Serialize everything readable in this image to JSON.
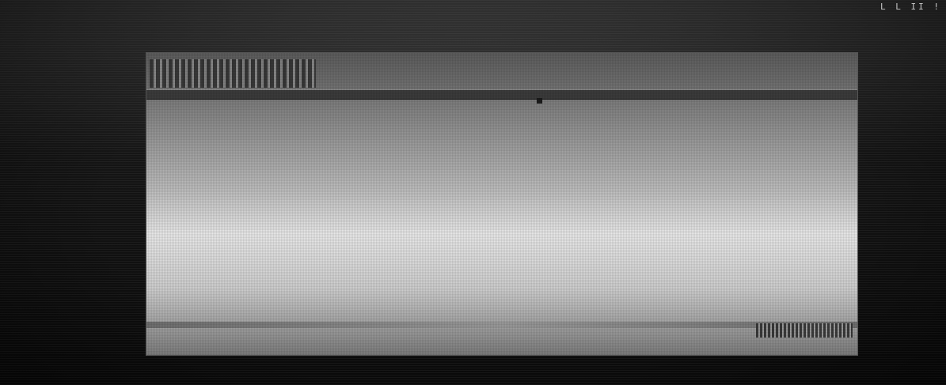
{
  "corner_mark": "L L  II !",
  "header": {
    "title": "",
    "subtitle": ""
  },
  "nav": {
    "items": [
      "",
      "",
      "",
      ""
    ]
  },
  "left_column": {
    "lines": [
      "",
      "",
      "",
      "",
      "",
      ""
    ]
  },
  "right_column": {
    "lines": [
      "",
      "",
      "",
      "",
      ""
    ]
  },
  "footer": {
    "text": ""
  },
  "colors": {
    "screen_highlight": "#e9e9e9",
    "screen_shadow": "#6d6d6d",
    "nav_bg": "#3b3b3b"
  }
}
